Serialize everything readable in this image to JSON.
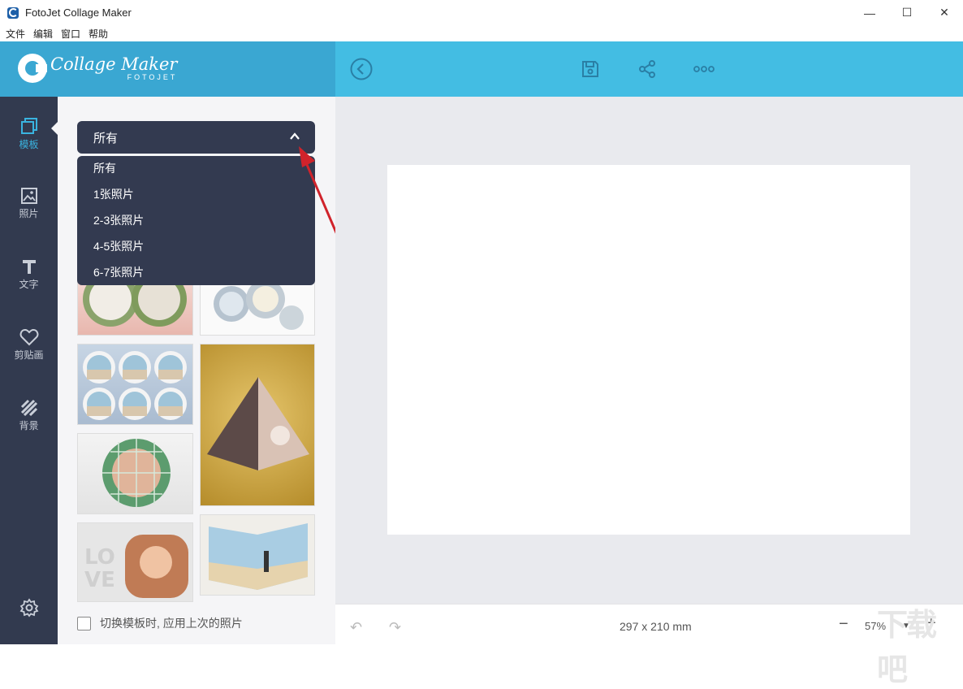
{
  "window": {
    "title": "FotoJet Collage Maker",
    "minimize": "—",
    "maximize": "☐",
    "close": "✕"
  },
  "menu": [
    "文件",
    "编辑",
    "窗口",
    "帮助"
  ],
  "logo": {
    "name": "Collage Maker",
    "sub": "FOTOJET"
  },
  "toolbar": {
    "icons": [
      "back-icon",
      "save-icon",
      "share-icon",
      "more-icon"
    ]
  },
  "sidebar": {
    "items": [
      {
        "label": "模板",
        "icon": "template-icon",
        "active": true
      },
      {
        "label": "照片",
        "icon": "photo-icon"
      },
      {
        "label": "文字",
        "icon": "text-icon"
      },
      {
        "label": "剪贴画",
        "icon": "clipart-icon"
      },
      {
        "label": "背景",
        "icon": "background-icon"
      }
    ],
    "settings_icon": "gear-icon"
  },
  "template_filter": {
    "selected": "所有",
    "options": [
      "所有",
      "1张照片",
      "2-3张照片",
      "4-5张照片",
      "6-7张照片"
    ]
  },
  "checkbox": {
    "label": "切换模板时, 应用上次的照片",
    "checked": false
  },
  "bottom": {
    "dimensions": "297 x 210 mm",
    "zoom": "57%",
    "zoom_minus": "−",
    "zoom_plus": "+"
  },
  "colors": {
    "brand": "#3aa7d2",
    "topbar": "#43bde3",
    "sidebar": "#323a4f",
    "dropdown": "#333a50",
    "annotation_arrow": "#d0232b"
  },
  "watermark": "下载吧"
}
